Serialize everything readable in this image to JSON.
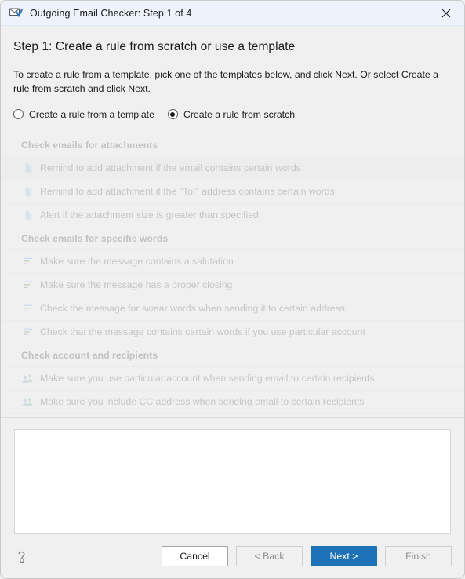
{
  "window": {
    "title": "Outgoing Email Checker: Step 1 of 4",
    "app_icon": "email-check-icon",
    "close_icon": "close-icon"
  },
  "step": {
    "title": "Step 1: Create a rule from scratch or use a template",
    "description": "To create a rule from a template, pick one of the templates below, and click Next. Or select Create a rule from scratch and click Next."
  },
  "mode_options": [
    {
      "label": "Create a rule from a template",
      "selected": false,
      "name": "radio-template"
    },
    {
      "label": "Create a rule from scratch",
      "selected": true,
      "name": "radio-scratch"
    }
  ],
  "template_groups": [
    {
      "heading": "Check emails for attachments",
      "icon": "paperclip-icon",
      "items": [
        {
          "label": "Remind to add attachment if the email contains certain words",
          "highlighted": true
        },
        {
          "label": "Remind to add attachment if the \"To:\" address contains certain words",
          "highlighted": false
        },
        {
          "label": "Alert if the attachment size is greater than specified",
          "highlighted": false
        }
      ]
    },
    {
      "heading": "Check emails for specific words",
      "icon": "text-lines-icon",
      "items": [
        {
          "label": "Make sure the message contains a salutation",
          "highlighted": false
        },
        {
          "label": "Make sure the message has a proper closing",
          "highlighted": false
        },
        {
          "label": "Check the message for swear words when sending it to certain address",
          "highlighted": false
        },
        {
          "label": "Check that the message contains certain words if you use particular account",
          "highlighted": false
        }
      ]
    },
    {
      "heading": "Check account and recipients",
      "icon": "people-icon",
      "items": [
        {
          "label": "Make sure you use particular account when sending email to certain recipients",
          "highlighted": false
        },
        {
          "label": "Make sure you include CC address when sending email to certain recipients",
          "highlighted": false
        }
      ]
    }
  ],
  "preview": {
    "content": ""
  },
  "footer": {
    "help_icon": "help-question-icon",
    "buttons": [
      {
        "label": "Cancel",
        "state": "enabled",
        "name": "cancel-button"
      },
      {
        "label": "< Back",
        "state": "disabled",
        "name": "back-button"
      },
      {
        "label": "Next >",
        "state": "primary",
        "name": "next-button"
      },
      {
        "label": "Finish",
        "state": "disabled",
        "name": "finish-button"
      }
    ]
  },
  "colors": {
    "accent": "#1d72b8",
    "titlebar": "#eef3fb",
    "dialog_bg": "#f0f0f0",
    "disabled_text": "#c6c6c6"
  }
}
